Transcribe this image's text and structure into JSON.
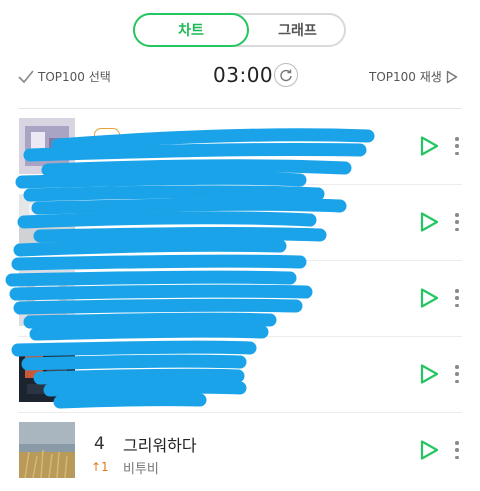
{
  "tabs": {
    "active_label": "차트",
    "inactive_label": "그래프"
  },
  "toolbar": {
    "select_label": "TOP100 선택",
    "timer": "03:00",
    "play_label": "TOP100 재생"
  },
  "colors": {
    "accent": "#23c660",
    "rank_change": "#e07a1a",
    "scribble": "#1aa3e8"
  },
  "songs": [
    {
      "rank": "",
      "change": "",
      "title": "",
      "artist": ""
    },
    {
      "rank": "",
      "change": "",
      "title": "",
      "artist": ""
    },
    {
      "rank": "",
      "change": "",
      "title": "",
      "artist": ""
    },
    {
      "rank": "",
      "change": "",
      "title": "",
      "artist": ""
    },
    {
      "rank": "4",
      "change": "↑1",
      "title": "그리워하다",
      "artist": "비투비"
    }
  ]
}
